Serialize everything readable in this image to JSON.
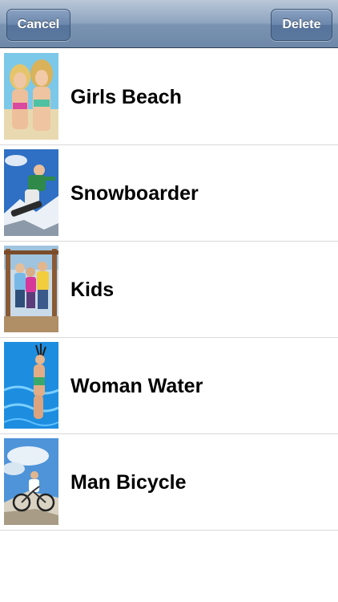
{
  "navbar": {
    "cancel_label": "Cancel",
    "delete_label": "Delete"
  },
  "items": [
    {
      "label": "Girls Beach",
      "icon": "girls-beach-thumbnail"
    },
    {
      "label": "Snowboarder",
      "icon": "snowboarder-thumbnail"
    },
    {
      "label": "Kids",
      "icon": "kids-thumbnail"
    },
    {
      "label": "Woman Water",
      "icon": "woman-water-thumbnail"
    },
    {
      "label": "Man Bicycle",
      "icon": "man-bicycle-thumbnail"
    }
  ],
  "colors": {
    "navbar": "#7a93b2",
    "separator": "#d9d9d9",
    "label": "#000000"
  }
}
